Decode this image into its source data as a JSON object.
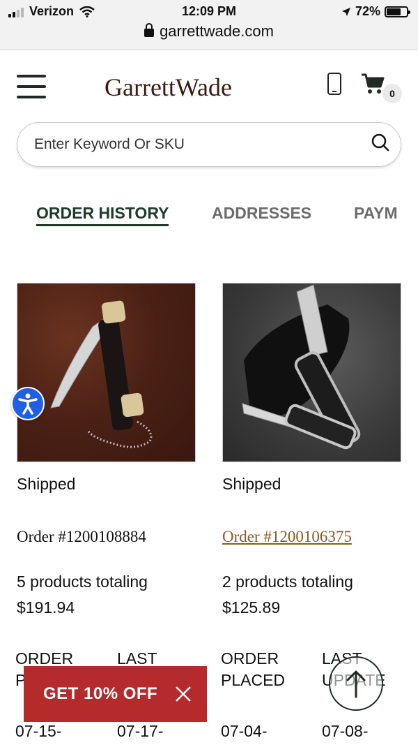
{
  "status_bar": {
    "carrier": "Verizon",
    "time": "12:09 PM",
    "battery": "72%",
    "battery_level": 0.72,
    "url": "garrettwade.com"
  },
  "header": {
    "logo": "GarrettWade",
    "cart_count": "0"
  },
  "search": {
    "placeholder": "Enter Keyword Or SKU"
  },
  "tabs": [
    {
      "label": "ORDER HISTORY",
      "active": true
    },
    {
      "label": "ADDRESSES",
      "active": false
    },
    {
      "label": "PAYM",
      "active": false
    }
  ],
  "orders": [
    {
      "status": "Shipped",
      "order_number": "Order #1200108884",
      "totals_line1": "5 products totaling",
      "totals_line2": "$191.94",
      "label_placed": "ORDER\nPLACED",
      "label_updated": "LAST",
      "date_placed": "07-15-",
      "date_updated": "07-17-"
    },
    {
      "status": "Shipped",
      "order_number": "Order #1200106375",
      "totals_line1": "2 products totaling",
      "totals_line2": "$125.89",
      "label_placed": "ORDER\nPLACED",
      "label_updated": "LAST\nUPDATE",
      "date_placed": "07-04-",
      "date_updated": "07-08-"
    }
  ],
  "promo": {
    "label": "GET 10% OFF"
  },
  "icons": [
    "hamburger-menu-icon",
    "phone-icon",
    "cart-icon",
    "search-icon",
    "accessibility-icon",
    "close-icon",
    "arrow-up-icon",
    "lock-icon",
    "wifi-icon",
    "location-arrow-icon",
    "battery-icon"
  ],
  "colors": {
    "brand_dark_green": "#1f3a2b",
    "logo_brown": "#3b1a12",
    "link_brown": "#8a5a22",
    "promo_red": "#b52a2a",
    "accessibility_blue": "#1f5ee5"
  }
}
